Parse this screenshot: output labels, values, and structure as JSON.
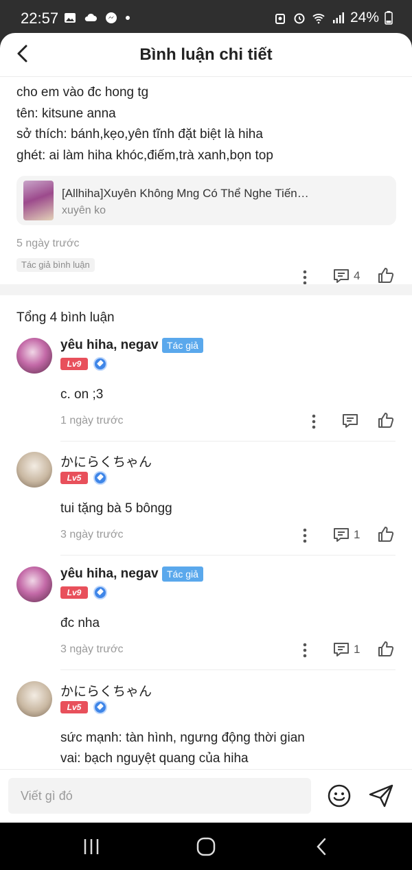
{
  "status_bar": {
    "time": "22:57",
    "battery": "24%",
    "left_icons": [
      "image-icon",
      "cloud-icon",
      "messenger-icon",
      "dot-icon"
    ],
    "right_icons": [
      "vpn-icon",
      "alarm-icon",
      "wifi-icon",
      "signal-icon",
      "battery-icon"
    ]
  },
  "header": {
    "title": "Bình luận chi tiết",
    "back_icon": "chevron-left-icon"
  },
  "original_comment": {
    "lines": [
      "cho em vào đc hong tg",
      "tên:  kitsune anna",
      "sở thích: bánh,kẹo,yên tĩnh đặt biệt là hiha",
      "ghét: ai làm hiha khóc,điếm,trà xanh,bọn top"
    ],
    "work": {
      "title": "[Allhiha]Xuyên Không Mng Có Thể Nghe Tiến…",
      "subtitle": "xuyên ko"
    },
    "time": "5 ngày trước",
    "reply_count": "4",
    "author_tag": "Tác giả bình luận"
  },
  "replies_section": {
    "total_label": "Tổng 4 bình luận",
    "items": [
      {
        "name": "yêu hiha, negav",
        "is_author": true,
        "author_badge": "Tác giả",
        "level": "Lv9",
        "lines": [
          "c. on ;3"
        ],
        "time": "1 ngày trước",
        "reply_count": ""
      },
      {
        "name": "かにらくちゃん",
        "is_author": false,
        "level": "Lv5",
        "lines": [
          "tui tặng bà 5 bôngg"
        ],
        "time": "3 ngày trước",
        "reply_count": "1"
      },
      {
        "name": "yêu hiha, negav",
        "is_author": true,
        "author_badge": "Tác giả",
        "level": "Lv9",
        "lines": [
          "đc nha"
        ],
        "time": "3 ngày trước",
        "reply_count": "1"
      },
      {
        "name": "かにらくちゃん",
        "is_author": false,
        "level": "Lv5",
        "lines": [
          "sức mạnh: tàn hình, ngưng động thời gian",
          "vai: bạch nguyệt quang của hiha"
        ],
        "time": "",
        "reply_count": ""
      }
    ]
  },
  "composer": {
    "placeholder": "Viết gì đó",
    "emoji_icon": "smiley-icon",
    "send_icon": "send-icon"
  },
  "colors": {
    "author_badge": "#5aa8ec",
    "level_badge": "#e8505b",
    "level_icon": "#3f86e8"
  }
}
